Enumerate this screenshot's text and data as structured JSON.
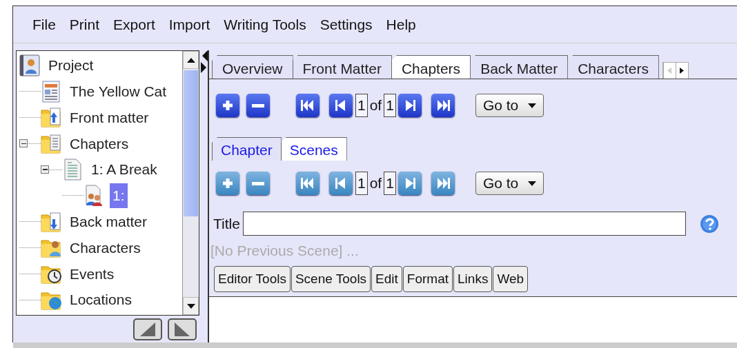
{
  "menu": [
    {
      "label": "File"
    },
    {
      "label": "Print"
    },
    {
      "label": "Export"
    },
    {
      "label": "Import"
    },
    {
      "label": "Writing Tools"
    },
    {
      "label": "Settings"
    },
    {
      "label": "Help"
    }
  ],
  "tree": {
    "label": "Project",
    "kind": "project",
    "selected": false,
    "children": [
      {
        "label": "The Yellow Cat",
        "kind": "document",
        "selected": false
      },
      {
        "label": "Front matter",
        "kind": "folder-up",
        "selected": false
      },
      {
        "label": "Chapters",
        "kind": "folder-doc",
        "selected": false,
        "expanded": true,
        "children": [
          {
            "label": "1: A Break",
            "kind": "page",
            "selected": false,
            "expanded": true,
            "children": [
              {
                "label": "1:",
                "kind": "scene",
                "selected": true
              }
            ]
          }
        ]
      },
      {
        "label": "Back matter",
        "kind": "folder-down",
        "selected": false
      },
      {
        "label": "Characters",
        "kind": "folder-person",
        "selected": false
      },
      {
        "label": "Events",
        "kind": "folder-clock",
        "selected": false
      },
      {
        "label": "Locations",
        "kind": "folder-globe",
        "selected": false
      }
    ]
  },
  "tabs": [
    {
      "label": "Overview",
      "selected": false
    },
    {
      "label": "Front Matter",
      "selected": false
    },
    {
      "label": "Chapters",
      "selected": true
    },
    {
      "label": "Back Matter",
      "selected": false
    },
    {
      "label": "Characters",
      "selected": false
    }
  ],
  "chapter_toolbar": {
    "disabled": false,
    "page": "1",
    "of": "of",
    "total": "1",
    "goto": "Go to"
  },
  "subtabs": [
    {
      "label": "Chapter",
      "selected": false
    },
    {
      "label": "Scenes",
      "selected": true
    }
  ],
  "scene_toolbar": {
    "disabled": true,
    "page": "1",
    "of": "of",
    "total": "1",
    "goto": "Go to"
  },
  "title_field": {
    "label": "Title"
  },
  "previous_scene": "[No Previous Scene] ...",
  "editor_tabs": [
    {
      "label": "Editor Tools"
    },
    {
      "label": "Scene Tools"
    },
    {
      "label": "Edit"
    },
    {
      "label": "Format"
    },
    {
      "label": "Links"
    },
    {
      "label": "Web"
    }
  ]
}
